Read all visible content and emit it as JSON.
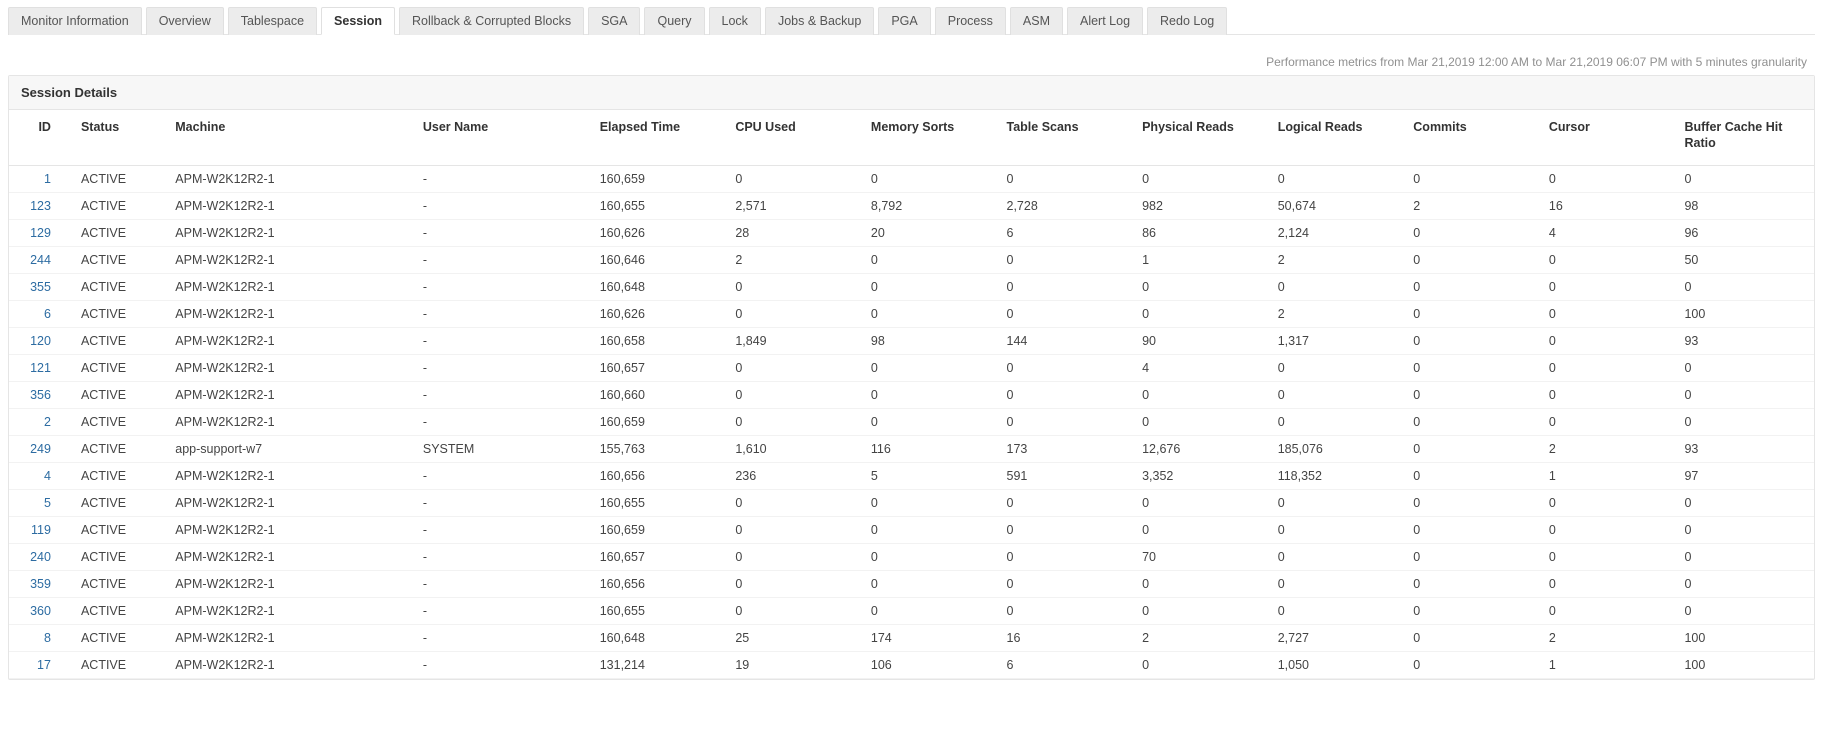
{
  "tabs": [
    {
      "label": "Monitor Information",
      "active": false
    },
    {
      "label": "Overview",
      "active": false
    },
    {
      "label": "Tablespace",
      "active": false
    },
    {
      "label": "Session",
      "active": true
    },
    {
      "label": "Rollback & Corrupted Blocks",
      "active": false
    },
    {
      "label": "SGA",
      "active": false
    },
    {
      "label": "Query",
      "active": false
    },
    {
      "label": "Lock",
      "active": false
    },
    {
      "label": "Jobs & Backup",
      "active": false
    },
    {
      "label": "PGA",
      "active": false
    },
    {
      "label": "Process",
      "active": false
    },
    {
      "label": "ASM",
      "active": false
    },
    {
      "label": "Alert Log",
      "active": false
    },
    {
      "label": "Redo Log",
      "active": false
    }
  ],
  "metrics_line": "Performance metrics from Mar 21,2019 12:00 AM to Mar 21,2019 06:07 PM with 5 minutes granularity",
  "panel": {
    "title": "Session Details"
  },
  "columns": {
    "id": "ID",
    "status": "Status",
    "machine": "Machine",
    "user": "User Name",
    "elapsed": "Elapsed Time",
    "cpu": "CPU Used",
    "memsorts": "Memory Sorts",
    "tablescans": "Table Scans",
    "physreads": "Physical Reads",
    "logreads": "Logical Reads",
    "commits": "Commits",
    "cursor": "Cursor",
    "buffer": "Buffer Cache Hit Ratio"
  },
  "rows": [
    {
      "id": "1",
      "status": "ACTIVE",
      "machine": "APM-W2K12R2-1",
      "user": "-",
      "elapsed": "160,659",
      "cpu": "0",
      "memsorts": "0",
      "tablescans": "0",
      "physreads": "0",
      "logreads": "0",
      "commits": "0",
      "cursor": "0",
      "buffer": "0"
    },
    {
      "id": "123",
      "status": "ACTIVE",
      "machine": "APM-W2K12R2-1",
      "user": "-",
      "elapsed": "160,655",
      "cpu": "2,571",
      "memsorts": "8,792",
      "tablescans": "2,728",
      "physreads": "982",
      "logreads": "50,674",
      "commits": "2",
      "cursor": "16",
      "buffer": "98"
    },
    {
      "id": "129",
      "status": "ACTIVE",
      "machine": "APM-W2K12R2-1",
      "user": "-",
      "elapsed": "160,626",
      "cpu": "28",
      "memsorts": "20",
      "tablescans": "6",
      "physreads": "86",
      "logreads": "2,124",
      "commits": "0",
      "cursor": "4",
      "buffer": "96"
    },
    {
      "id": "244",
      "status": "ACTIVE",
      "machine": "APM-W2K12R2-1",
      "user": "-",
      "elapsed": "160,646",
      "cpu": "2",
      "memsorts": "0",
      "tablescans": "0",
      "physreads": "1",
      "logreads": "2",
      "commits": "0",
      "cursor": "0",
      "buffer": "50"
    },
    {
      "id": "355",
      "status": "ACTIVE",
      "machine": "APM-W2K12R2-1",
      "user": "-",
      "elapsed": "160,648",
      "cpu": "0",
      "memsorts": "0",
      "tablescans": "0",
      "physreads": "0",
      "logreads": "0",
      "commits": "0",
      "cursor": "0",
      "buffer": "0"
    },
    {
      "id": "6",
      "status": "ACTIVE",
      "machine": "APM-W2K12R2-1",
      "user": "-",
      "elapsed": "160,626",
      "cpu": "0",
      "memsorts": "0",
      "tablescans": "0",
      "physreads": "0",
      "logreads": "2",
      "commits": "0",
      "cursor": "0",
      "buffer": "100"
    },
    {
      "id": "120",
      "status": "ACTIVE",
      "machine": "APM-W2K12R2-1",
      "user": "-",
      "elapsed": "160,658",
      "cpu": "1,849",
      "memsorts": "98",
      "tablescans": "144",
      "physreads": "90",
      "logreads": "1,317",
      "commits": "0",
      "cursor": "0",
      "buffer": "93"
    },
    {
      "id": "121",
      "status": "ACTIVE",
      "machine": "APM-W2K12R2-1",
      "user": "-",
      "elapsed": "160,657",
      "cpu": "0",
      "memsorts": "0",
      "tablescans": "0",
      "physreads": "4",
      "logreads": "0",
      "commits": "0",
      "cursor": "0",
      "buffer": "0"
    },
    {
      "id": "356",
      "status": "ACTIVE",
      "machine": "APM-W2K12R2-1",
      "user": "-",
      "elapsed": "160,660",
      "cpu": "0",
      "memsorts": "0",
      "tablescans": "0",
      "physreads": "0",
      "logreads": "0",
      "commits": "0",
      "cursor": "0",
      "buffer": "0"
    },
    {
      "id": "2",
      "status": "ACTIVE",
      "machine": "APM-W2K12R2-1",
      "user": "-",
      "elapsed": "160,659",
      "cpu": "0",
      "memsorts": "0",
      "tablescans": "0",
      "physreads": "0",
      "logreads": "0",
      "commits": "0",
      "cursor": "0",
      "buffer": "0"
    },
    {
      "id": "249",
      "status": "ACTIVE",
      "machine": "app-support-w7",
      "user": "SYSTEM",
      "elapsed": "155,763",
      "cpu": "1,610",
      "memsorts": "116",
      "tablescans": "173",
      "physreads": "12,676",
      "logreads": "185,076",
      "commits": "0",
      "cursor": "2",
      "buffer": "93"
    },
    {
      "id": "4",
      "status": "ACTIVE",
      "machine": "APM-W2K12R2-1",
      "user": "-",
      "elapsed": "160,656",
      "cpu": "236",
      "memsorts": "5",
      "tablescans": "591",
      "physreads": "3,352",
      "logreads": "118,352",
      "commits": "0",
      "cursor": "1",
      "buffer": "97"
    },
    {
      "id": "5",
      "status": "ACTIVE",
      "machine": "APM-W2K12R2-1",
      "user": "-",
      "elapsed": "160,655",
      "cpu": "0",
      "memsorts": "0",
      "tablescans": "0",
      "physreads": "0",
      "logreads": "0",
      "commits": "0",
      "cursor": "0",
      "buffer": "0"
    },
    {
      "id": "119",
      "status": "ACTIVE",
      "machine": "APM-W2K12R2-1",
      "user": "-",
      "elapsed": "160,659",
      "cpu": "0",
      "memsorts": "0",
      "tablescans": "0",
      "physreads": "0",
      "logreads": "0",
      "commits": "0",
      "cursor": "0",
      "buffer": "0"
    },
    {
      "id": "240",
      "status": "ACTIVE",
      "machine": "APM-W2K12R2-1",
      "user": "-",
      "elapsed": "160,657",
      "cpu": "0",
      "memsorts": "0",
      "tablescans": "0",
      "physreads": "70",
      "logreads": "0",
      "commits": "0",
      "cursor": "0",
      "buffer": "0"
    },
    {
      "id": "359",
      "status": "ACTIVE",
      "machine": "APM-W2K12R2-1",
      "user": "-",
      "elapsed": "160,656",
      "cpu": "0",
      "memsorts": "0",
      "tablescans": "0",
      "physreads": "0",
      "logreads": "0",
      "commits": "0",
      "cursor": "0",
      "buffer": "0"
    },
    {
      "id": "360",
      "status": "ACTIVE",
      "machine": "APM-W2K12R2-1",
      "user": "-",
      "elapsed": "160,655",
      "cpu": "0",
      "memsorts": "0",
      "tablescans": "0",
      "physreads": "0",
      "logreads": "0",
      "commits": "0",
      "cursor": "0",
      "buffer": "0"
    },
    {
      "id": "8",
      "status": "ACTIVE",
      "machine": "APM-W2K12R2-1",
      "user": "-",
      "elapsed": "160,648",
      "cpu": "25",
      "memsorts": "174",
      "tablescans": "16",
      "physreads": "2",
      "logreads": "2,727",
      "commits": "0",
      "cursor": "2",
      "buffer": "100"
    },
    {
      "id": "17",
      "status": "ACTIVE",
      "machine": "APM-W2K12R2-1",
      "user": "-",
      "elapsed": "131,214",
      "cpu": "19",
      "memsorts": "106",
      "tablescans": "6",
      "physreads": "0",
      "logreads": "1,050",
      "commits": "0",
      "cursor": "1",
      "buffer": "100"
    }
  ]
}
